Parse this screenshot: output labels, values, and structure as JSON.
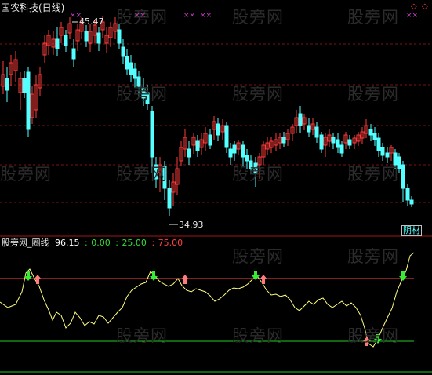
{
  "chart_title": "国农科技(日线)",
  "watermark": "股旁网",
  "price_panel": {
    "high_label": "45.47",
    "low_label": "34.93",
    "corner_marker": "◇",
    "cross_marker": "××",
    "tag": "阴材",
    "colors": {
      "up": "#ff3b3b",
      "down": "#54ffff",
      "grid": "#7a1212"
    }
  },
  "indicator_panel": {
    "name": "股旁网_圈线",
    "value": "96.15",
    "level_low": "0.00",
    "level_mid": "25.00",
    "level_high": "75.00",
    "separator": ":",
    "colors": {
      "line": "#ffff80",
      "high_line": "#ff4040",
      "low_line": "#22cc22",
      "buy_arrow": "#ff7a7a",
      "sell_arrow": "#33ee33"
    }
  }
}
